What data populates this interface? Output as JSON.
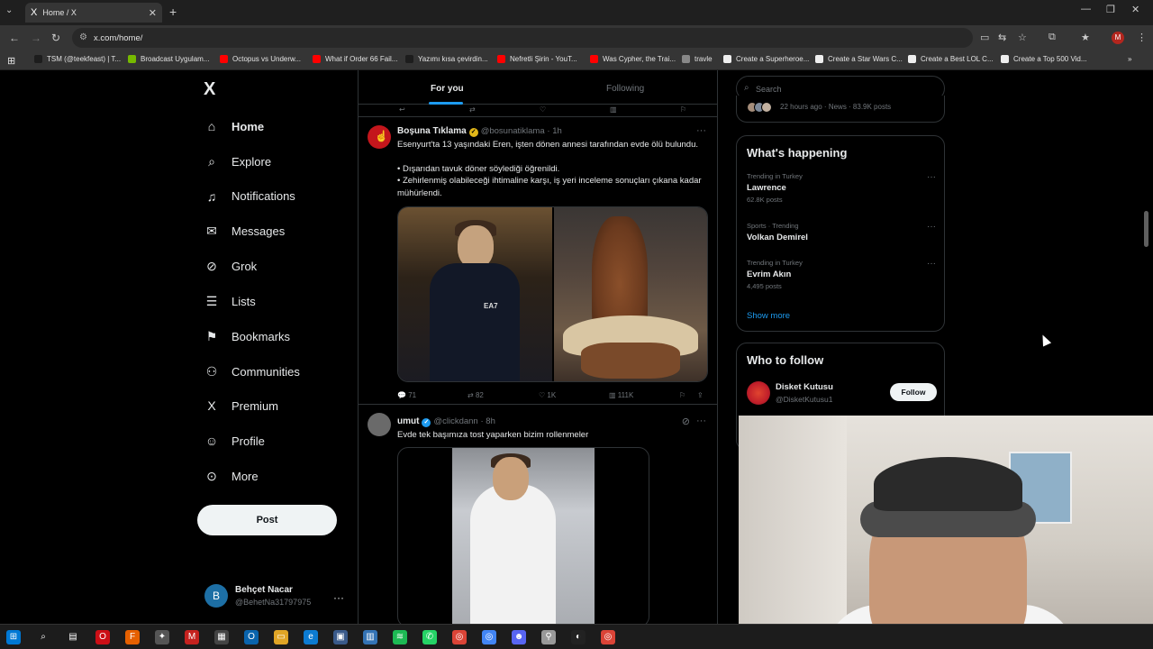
{
  "browser": {
    "tab_title": "Home / X",
    "url": "x.com/home/",
    "bookmarks": [
      {
        "label": "TSM (@teekfeast) | T...",
        "color": "#1d1d1d"
      },
      {
        "label": "Broadcast Uygulam...",
        "color": "#76b900"
      },
      {
        "label": "Octopus vs Underw...",
        "color": "#ff0000"
      },
      {
        "label": "What if Order 66 Fail...",
        "color": "#ff0000"
      },
      {
        "label": "Yazımı kısa çevirdin...",
        "color": "#1d1d1d"
      },
      {
        "label": "Nefretli Şirin - YouT...",
        "color": "#ff0000"
      },
      {
        "label": "Was Cypher, the Trai...",
        "color": "#ff0000"
      },
      {
        "label": "travle",
        "color": "#888888"
      },
      {
        "label": "Create a Superheroe...",
        "color": "#eeeeee"
      },
      {
        "label": "Create a Star Wars C...",
        "color": "#eeeeee"
      },
      {
        "label": "Create a Best LOL C...",
        "color": "#eeeeee"
      },
      {
        "label": "Create a Top 500 Vid...",
        "color": "#eeeeee"
      }
    ],
    "profile_initial": "M"
  },
  "sidebar": {
    "logo": "X",
    "items": [
      {
        "label": "Home",
        "icon": "home-icon",
        "glyph": "⌂"
      },
      {
        "label": "Explore",
        "icon": "search-icon",
        "glyph": "⌕"
      },
      {
        "label": "Notifications",
        "icon": "bell-icon",
        "glyph": "♫"
      },
      {
        "label": "Messages",
        "icon": "mail-icon",
        "glyph": "✉"
      },
      {
        "label": "Grok",
        "icon": "grok-icon",
        "glyph": "⊘"
      },
      {
        "label": "Lists",
        "icon": "list-icon",
        "glyph": "☰"
      },
      {
        "label": "Bookmarks",
        "icon": "bookmark-icon",
        "glyph": "⚑"
      },
      {
        "label": "Communities",
        "icon": "people-icon",
        "glyph": "⚇"
      },
      {
        "label": "Premium",
        "icon": "x-premium-icon",
        "glyph": "X"
      },
      {
        "label": "Profile",
        "icon": "person-icon",
        "glyph": "☺"
      },
      {
        "label": "More",
        "icon": "more-circle-icon",
        "glyph": "⊙"
      }
    ],
    "post_label": "Post",
    "account": {
      "initial": "B",
      "name": "Behçet Nacar",
      "handle": "@BehetNa31797975"
    }
  },
  "timeline": {
    "tabs": [
      "For you",
      "Following"
    ],
    "tweets": [
      {
        "name": "Boşuna Tıklama",
        "handle": "@bosunatiklama",
        "time": "· 1h",
        "text": "Esenyurt'ta 13 yaşındaki Eren, işten dönen annesi tarafından evde ölü bulundu.",
        "bullets": [
          "• Dışarıdan tavuk döner söylediği öğrenildi.",
          "• Zehirlenmiş olabileceği ihtimaline karşı, iş yeri inceleme sonuçları çıkana kadar mühürlendi."
        ],
        "image_text": "EA7",
        "replies": "71",
        "reposts": "82",
        "likes": "1K",
        "views": "111K"
      },
      {
        "name": "umut",
        "handle": "@clickdann",
        "time": "· 8h",
        "text": "Evde tek başımıza tost yaparken bizim rollenmeler"
      }
    ]
  },
  "right": {
    "search_placeholder": "Search",
    "news_meta": "22 hours ago · News · 83.9K posts",
    "happening_title": "What's happening",
    "trends": [
      {
        "context": "Trending in Turkey",
        "title": "Lawrence",
        "count": "62.8K posts"
      },
      {
        "context": "Sports · Trending",
        "title": "Volkan Demirel",
        "count": ""
      },
      {
        "context": "Trending in Turkey",
        "title": "Evrim Akın",
        "count": "4,495 posts"
      }
    ],
    "show_more": "Show more",
    "wtf_title": "Who to follow",
    "wtf": {
      "name": "Disket Kutusu",
      "handle": "@DisketKutusu1",
      "button": "Follow"
    }
  },
  "colors": {
    "accent": "#1d9bf0",
    "bg": "#000000",
    "border": "#2f3336",
    "muted": "#71767b"
  }
}
